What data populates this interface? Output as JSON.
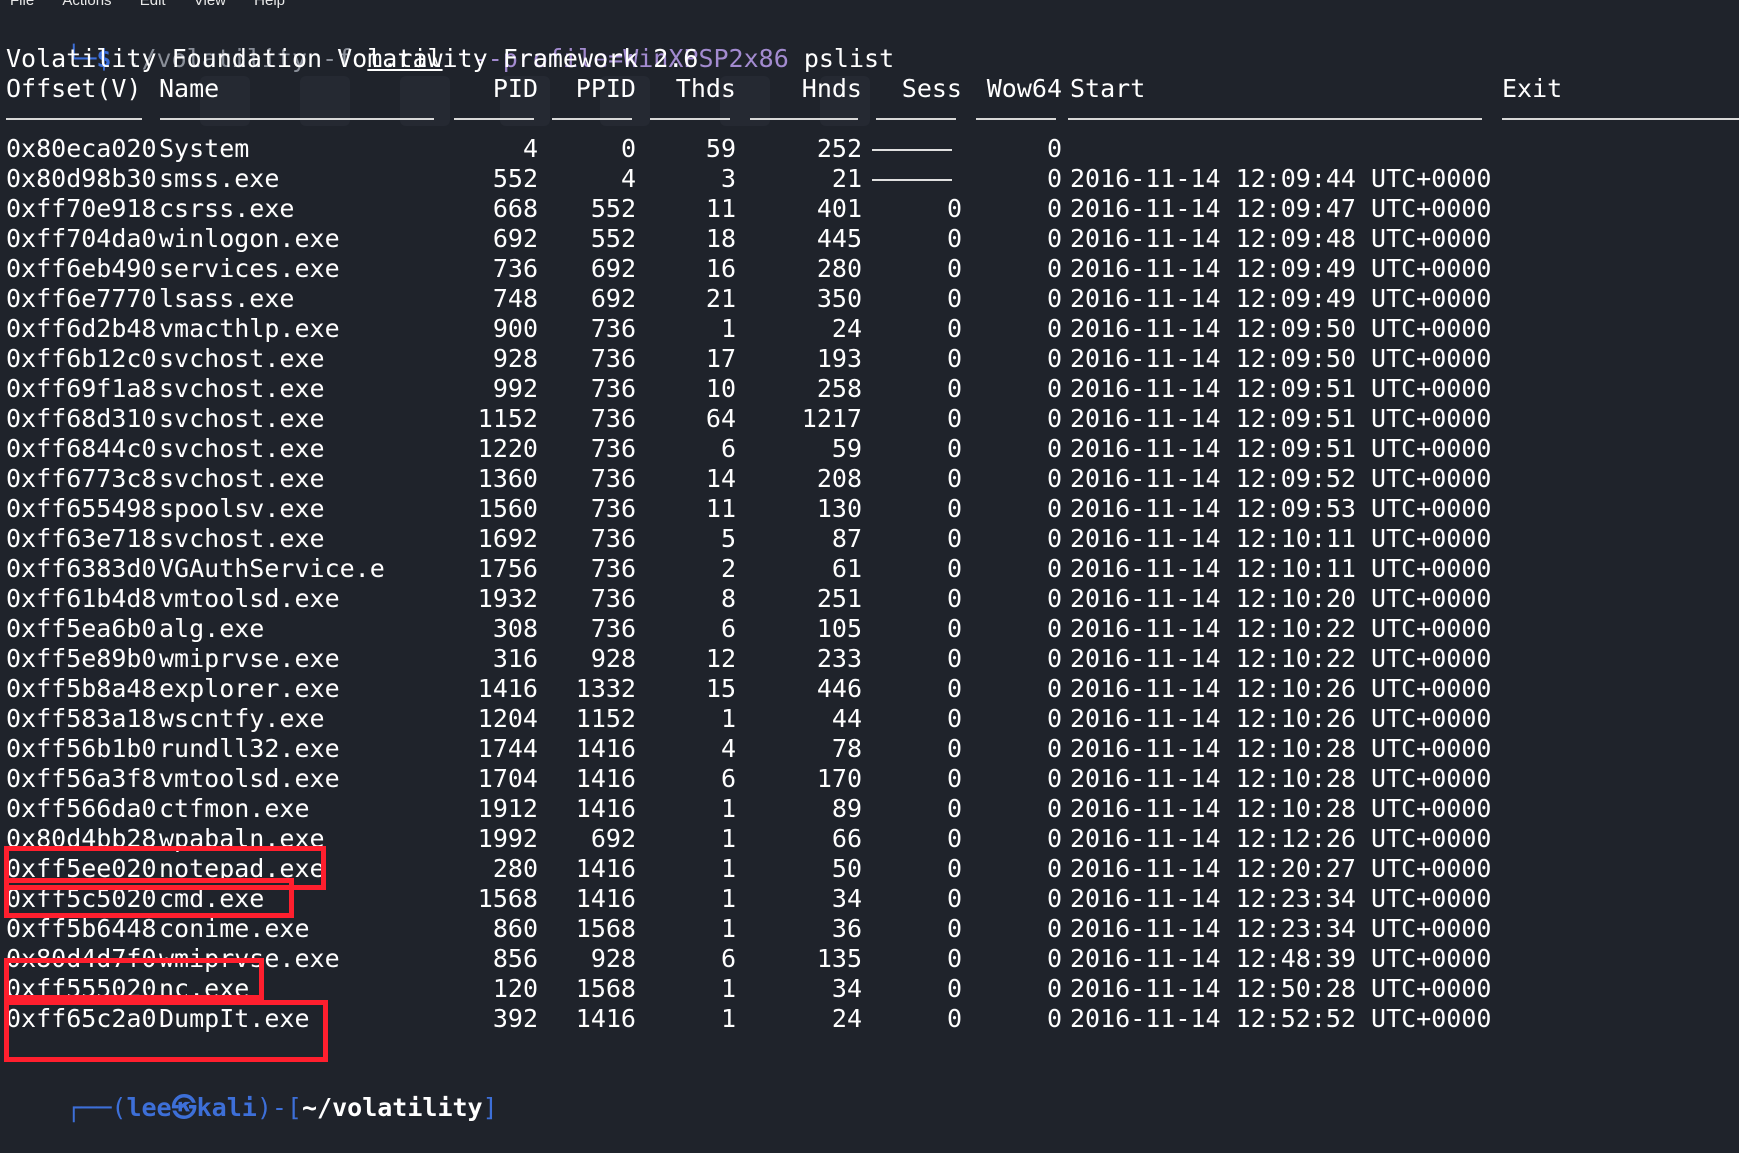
{
  "menu": [
    "File",
    "Actions",
    "Edit",
    "View",
    "Help"
  ],
  "command": {
    "prompt_corner": "└─",
    "prompt_symbol": "$",
    "program": "./volatility",
    "flag": "-f",
    "file": "m.raw",
    "profile": "--profile=WinXPSP2x86",
    "plugin": "pslist"
  },
  "banner": "Volatility Foundation Volatility Framework 2.6",
  "headers": [
    "Offset(V)",
    "Name",
    "PID",
    "PPID",
    "Thds",
    "Hnds",
    "Sess",
    "Wow64",
    "Start",
    "Exit"
  ],
  "rows": [
    [
      "0x80eca020",
      "System",
      "4",
      "0",
      "59",
      "252",
      "",
      "0",
      ""
    ],
    [
      "0x80d98b30",
      "smss.exe",
      "552",
      "4",
      "3",
      "21",
      "",
      "0",
      "2016-11-14 12:09:44 UTC+0000"
    ],
    [
      "0xff70e918",
      "csrss.exe",
      "668",
      "552",
      "11",
      "401",
      "0",
      "0",
      "2016-11-14 12:09:47 UTC+0000"
    ],
    [
      "0xff704da0",
      "winlogon.exe",
      "692",
      "552",
      "18",
      "445",
      "0",
      "0",
      "2016-11-14 12:09:48 UTC+0000"
    ],
    [
      "0xff6eb490",
      "services.exe",
      "736",
      "692",
      "16",
      "280",
      "0",
      "0",
      "2016-11-14 12:09:49 UTC+0000"
    ],
    [
      "0xff6e7770",
      "lsass.exe",
      "748",
      "692",
      "21",
      "350",
      "0",
      "0",
      "2016-11-14 12:09:49 UTC+0000"
    ],
    [
      "0xff6d2b48",
      "vmacthlp.exe",
      "900",
      "736",
      "1",
      "24",
      "0",
      "0",
      "2016-11-14 12:09:50 UTC+0000"
    ],
    [
      "0xff6b12c0",
      "svchost.exe",
      "928",
      "736",
      "17",
      "193",
      "0",
      "0",
      "2016-11-14 12:09:50 UTC+0000"
    ],
    [
      "0xff69f1a8",
      "svchost.exe",
      "992",
      "736",
      "10",
      "258",
      "0",
      "0",
      "2016-11-14 12:09:51 UTC+0000"
    ],
    [
      "0xff68d310",
      "svchost.exe",
      "1152",
      "736",
      "64",
      "1217",
      "0",
      "0",
      "2016-11-14 12:09:51 UTC+0000"
    ],
    [
      "0xff6844c0",
      "svchost.exe",
      "1220",
      "736",
      "6",
      "59",
      "0",
      "0",
      "2016-11-14 12:09:51 UTC+0000"
    ],
    [
      "0xff6773c8",
      "svchost.exe",
      "1360",
      "736",
      "14",
      "208",
      "0",
      "0",
      "2016-11-14 12:09:52 UTC+0000"
    ],
    [
      "0xff655498",
      "spoolsv.exe",
      "1560",
      "736",
      "11",
      "130",
      "0",
      "0",
      "2016-11-14 12:09:53 UTC+0000"
    ],
    [
      "0xff63e718",
      "svchost.exe",
      "1692",
      "736",
      "5",
      "87",
      "0",
      "0",
      "2016-11-14 12:10:11 UTC+0000"
    ],
    [
      "0xff6383d0",
      "VGAuthService.e",
      "1756",
      "736",
      "2",
      "61",
      "0",
      "0",
      "2016-11-14 12:10:11 UTC+0000"
    ],
    [
      "0xff61b4d8",
      "vmtoolsd.exe",
      "1932",
      "736",
      "8",
      "251",
      "0",
      "0",
      "2016-11-14 12:10:20 UTC+0000"
    ],
    [
      "0xff5ea6b0",
      "alg.exe",
      "308",
      "736",
      "6",
      "105",
      "0",
      "0",
      "2016-11-14 12:10:22 UTC+0000"
    ],
    [
      "0xff5e89b0",
      "wmiprvse.exe",
      "316",
      "928",
      "12",
      "233",
      "0",
      "0",
      "2016-11-14 12:10:22 UTC+0000"
    ],
    [
      "0xff5b8a48",
      "explorer.exe",
      "1416",
      "1332",
      "15",
      "446",
      "0",
      "0",
      "2016-11-14 12:10:26 UTC+0000"
    ],
    [
      "0xff583a18",
      "wscntfy.exe",
      "1204",
      "1152",
      "1",
      "44",
      "0",
      "0",
      "2016-11-14 12:10:26 UTC+0000"
    ],
    [
      "0xff56b1b0",
      "rundll32.exe",
      "1744",
      "1416",
      "4",
      "78",
      "0",
      "0",
      "2016-11-14 12:10:28 UTC+0000"
    ],
    [
      "0xff56a3f8",
      "vmtoolsd.exe",
      "1704",
      "1416",
      "6",
      "170",
      "0",
      "0",
      "2016-11-14 12:10:28 UTC+0000"
    ],
    [
      "0xff566da0",
      "ctfmon.exe",
      "1912",
      "1416",
      "1",
      "89",
      "0",
      "0",
      "2016-11-14 12:10:28 UTC+0000"
    ],
    [
      "0x80d4bb28",
      "wpabaln.exe",
      "1992",
      "692",
      "1",
      "66",
      "0",
      "0",
      "2016-11-14 12:12:26 UTC+0000"
    ],
    [
      "0xff5ee020",
      "notepad.exe",
      "280",
      "1416",
      "1",
      "50",
      "0",
      "0",
      "2016-11-14 12:20:27 UTC+0000"
    ],
    [
      "0xff5c5020",
      "cmd.exe",
      "1568",
      "1416",
      "1",
      "34",
      "0",
      "0",
      "2016-11-14 12:23:34 UTC+0000"
    ],
    [
      "0xff5b6448",
      "conime.exe",
      "860",
      "1568",
      "1",
      "36",
      "0",
      "0",
      "2016-11-14 12:23:34 UTC+0000"
    ],
    [
      "0x80d4d7f0",
      "wmiprvse.exe",
      "856",
      "928",
      "6",
      "135",
      "0",
      "0",
      "2016-11-14 12:48:39 UTC+0000"
    ],
    [
      "0xff555020",
      "nc.exe",
      "120",
      "1568",
      "1",
      "34",
      "0",
      "0",
      "2016-11-14 12:50:28 UTC+0000"
    ],
    [
      "0xff65c2a0",
      "DumpIt.exe",
      "392",
      "1416",
      "1",
      "24",
      "0",
      "0",
      "2016-11-14 12:52:52 UTC+0000"
    ]
  ],
  "prompt": {
    "open": "┌──(",
    "user": "lee",
    "at": "㉿",
    "host": "kali",
    "mid": ")-[",
    "path": "~/volatility",
    "close": "]"
  },
  "highlight_color": "#ff1f2e",
  "accent_color": "#3d6fd8"
}
